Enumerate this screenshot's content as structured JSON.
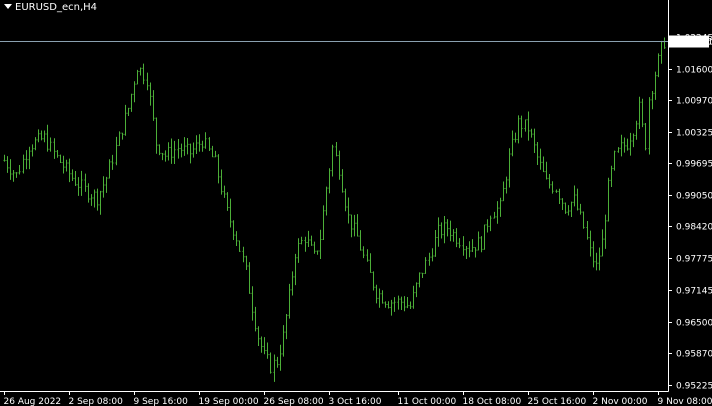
{
  "window": {
    "symbol_label": "EURUSD_ecn,H4"
  },
  "colors": {
    "background": "#000000",
    "bars": "#4caf38",
    "axis": "#ffffff",
    "price_line": "#8aa0b0"
  },
  "current_price": {
    "label": "1.02151",
    "value": 1.02151
  },
  "chart_data": {
    "type": "bar",
    "title": "EURUSD_ecn,H4",
    "xlabel": "",
    "ylabel": "",
    "ylim": [
      0.951,
      1.027
    ],
    "grid": false,
    "y_ticks": [
      {
        "value": 1.02245,
        "label": "1.02245"
      },
      {
        "value": 1.016,
        "label": "1.01600"
      },
      {
        "value": 1.0097,
        "label": "1.00970"
      },
      {
        "value": 1.00325,
        "label": "1.00325"
      },
      {
        "value": 0.99695,
        "label": "0.99695"
      },
      {
        "value": 0.9905,
        "label": "0.99050"
      },
      {
        "value": 0.9842,
        "label": "0.98420"
      },
      {
        "value": 0.97775,
        "label": "0.97775"
      },
      {
        "value": 0.97145,
        "label": "0.97145"
      },
      {
        "value": 0.965,
        "label": "0.96500"
      },
      {
        "value": 0.9587,
        "label": "0.95870"
      },
      {
        "value": 0.95225,
        "label": "0.95225"
      }
    ],
    "x_ticks": [
      {
        "index": 0,
        "label": "26 Aug 2022"
      },
      {
        "index": 21,
        "label": "2 Sep 08:00"
      },
      {
        "index": 42,
        "label": "9 Sep 16:00"
      },
      {
        "index": 63,
        "label": "19 Sep 00:00"
      },
      {
        "index": 84,
        "label": "26 Sep 08:00"
      },
      {
        "index": 105,
        "label": "3 Oct 16:00"
      },
      {
        "index": 127,
        "label": "11 Oct 00:00"
      },
      {
        "index": 148,
        "label": "18 Oct 08:00"
      },
      {
        "index": 169,
        "label": "25 Oct 16:00"
      },
      {
        "index": 190,
        "label": "2 Nov 00:00"
      },
      {
        "index": 211,
        "label": "9 Nov 08:00"
      }
    ],
    "close_path": [
      [
        0,
        0.9975
      ],
      [
        4,
        0.9945
      ],
      [
        8,
        1.0005
      ],
      [
        13,
        1.002
      ],
      [
        17,
        0.998
      ],
      [
        22,
        0.994
      ],
      [
        26,
        0.9915
      ],
      [
        30,
        0.99
      ],
      [
        33,
        0.994
      ],
      [
        36,
        1.0
      ],
      [
        40,
        1.008
      ],
      [
        43,
        1.0165
      ],
      [
        46,
        1.014
      ],
      [
        49,
        1.001
      ],
      [
        52,
        0.9985
      ],
      [
        56,
        1.0
      ],
      [
        60,
        0.999
      ],
      [
        64,
        1.0015
      ],
      [
        68,
        0.997
      ],
      [
        72,
        0.987
      ],
      [
        75,
        0.982
      ],
      [
        78,
        0.975
      ],
      [
        80,
        0.968
      ],
      [
        82,
        0.962
      ],
      [
        84,
        0.958
      ],
      [
        86,
        0.956
      ],
      [
        88,
        0.957
      ],
      [
        90,
        0.962
      ],
      [
        92,
        0.97
      ],
      [
        94,
        0.979
      ],
      [
        97,
        0.982
      ],
      [
        100,
        0.978
      ],
      [
        102,
        0.982
      ],
      [
        104,
        0.992
      ],
      [
        106,
        1.0
      ],
      [
        108,
        0.996
      ],
      [
        111,
        0.986
      ],
      [
        114,
        0.982
      ],
      [
        117,
        0.976
      ],
      [
        120,
        0.971
      ],
      [
        124,
        0.969
      ],
      [
        128,
        0.969
      ],
      [
        131,
        0.968
      ],
      [
        134,
        0.974
      ],
      [
        137,
        0.978
      ],
      [
        140,
        0.983
      ],
      [
        143,
        0.984
      ],
      [
        146,
        0.982
      ],
      [
        150,
        0.98
      ],
      [
        154,
        0.981
      ],
      [
        157,
        0.987
      ],
      [
        160,
        0.988
      ],
      [
        163,
        0.998
      ],
      [
        166,
        1.005
      ],
      [
        169,
        1.004
      ],
      [
        172,
        0.998
      ],
      [
        175,
        0.993
      ],
      [
        178,
        0.992
      ],
      [
        181,
        0.988
      ],
      [
        184,
        0.9895
      ],
      [
        187,
        0.984
      ],
      [
        189,
        0.979
      ],
      [
        191,
        0.976
      ],
      [
        193,
        0.981
      ],
      [
        195,
        0.992
      ],
      [
        197,
        0.998
      ],
      [
        199,
        1.0
      ],
      [
        201,
        1.001
      ],
      [
        203,
        1.004
      ],
      [
        205,
        1.008
      ],
      [
        206,
        1.004
      ],
      [
        207,
        1.001
      ],
      [
        208,
        1.01
      ],
      [
        210,
        1.015
      ],
      [
        212,
        1.02
      ],
      [
        213,
        1.0215
      ]
    ]
  }
}
